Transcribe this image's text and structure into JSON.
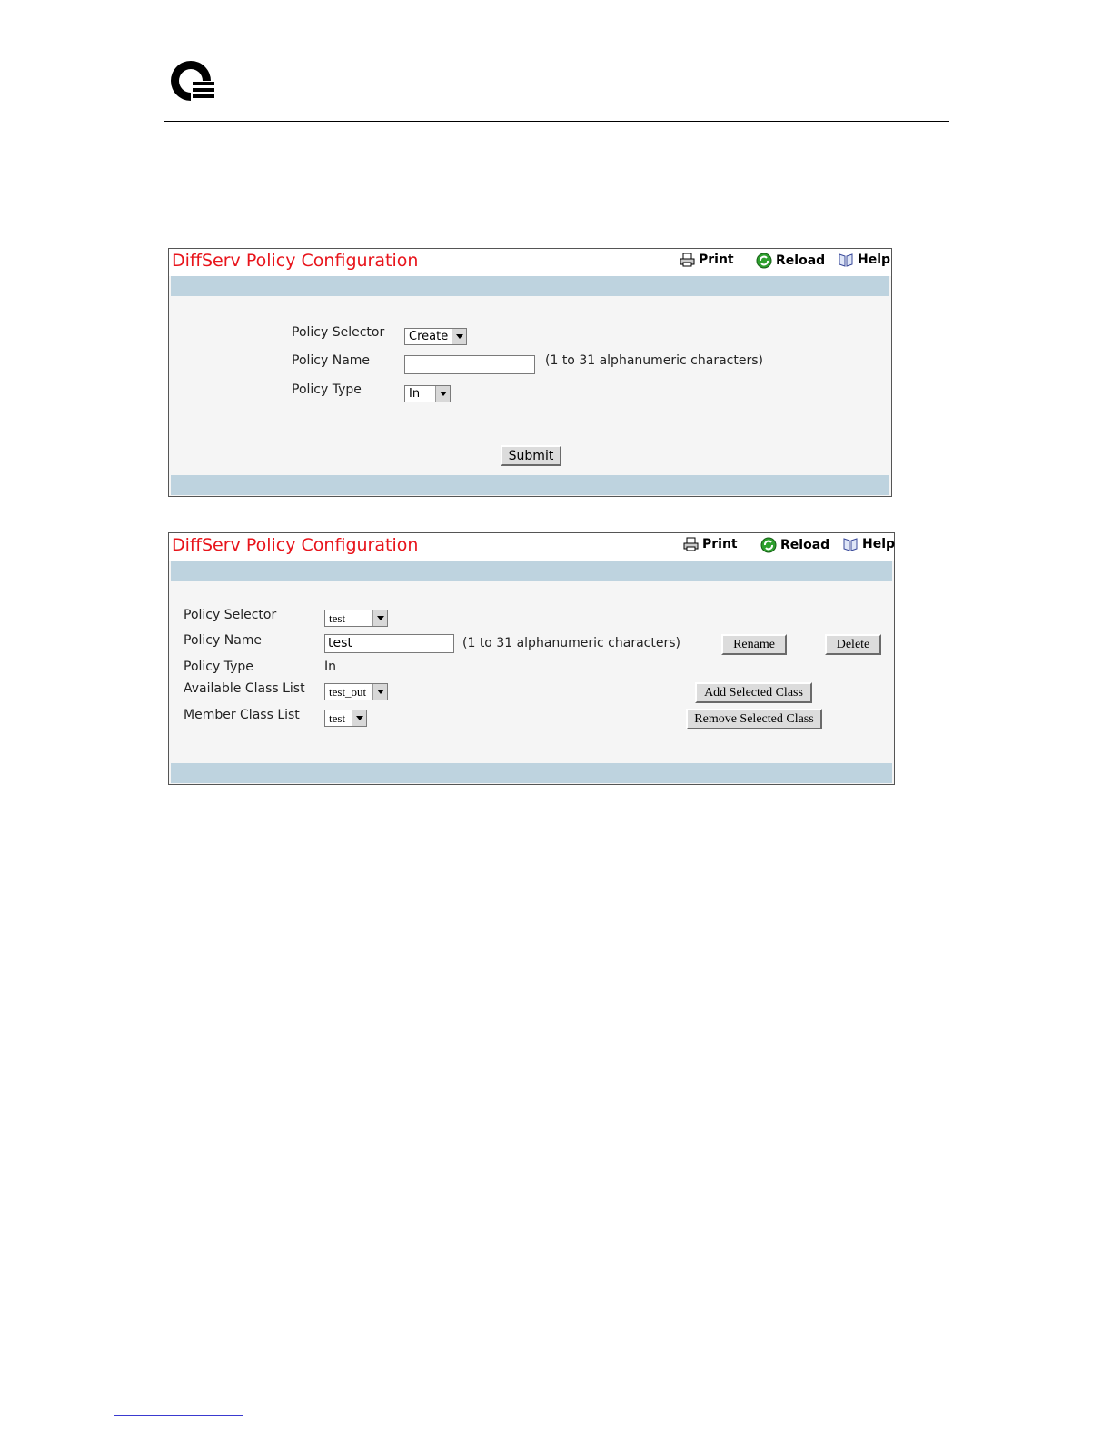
{
  "colors": {
    "title_red": "#e8141b",
    "band_blue": "#bed3df",
    "panel_bg": "#f5f5f5"
  },
  "panel1": {
    "title": "DiffServ Policy Configuration",
    "toolbar": {
      "print": "Print",
      "reload": "Reload",
      "help": "Help"
    },
    "policy_selector_label": "Policy Selector",
    "policy_selector_value": "Create",
    "policy_name_label": "Policy Name",
    "policy_name_value": "",
    "policy_name_hint": "(1 to 31 alphanumeric characters)",
    "policy_type_label": "Policy Type",
    "policy_type_value": "In",
    "submit_label": "Submit"
  },
  "panel2": {
    "title": "DiffServ Policy Configuration",
    "toolbar": {
      "print": "Print",
      "reload": "Reload",
      "help": "Help"
    },
    "policy_selector_label": "Policy Selector",
    "policy_selector_value": "test",
    "policy_name_label": "Policy Name",
    "policy_name_value": "test",
    "policy_name_hint": "(1 to 31 alphanumeric characters)",
    "policy_type_label": "Policy Type",
    "policy_type_value": "In",
    "available_class_label": "Available Class List",
    "available_class_value": "test_out",
    "member_class_label": "Member Class List",
    "member_class_value": "test",
    "rename_label": "Rename",
    "delete_label": "Delete",
    "add_class_label": "Add Selected Class",
    "remove_class_label": "Remove Selected Class"
  },
  "icons": [
    "company-logo",
    "printer-icon",
    "reload-icon",
    "help-book-icon",
    "chevron-down-icon"
  ]
}
